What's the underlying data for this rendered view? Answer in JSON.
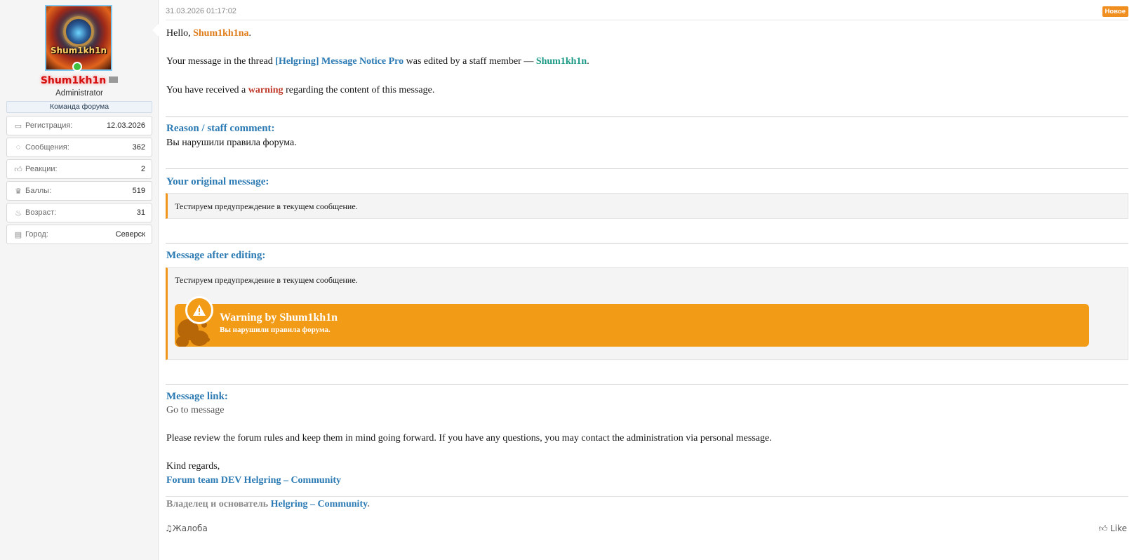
{
  "user": {
    "username": "Shum1kh1n",
    "title": "Administrator",
    "team_badge": "Команда форума",
    "avatar_text": "Shum1kh1n",
    "stats": [
      {
        "icon": "calendar-icon",
        "label": "Регистрация:",
        "value": "12.03.2026"
      },
      {
        "icon": "messages-icon",
        "label": "Сообщения:",
        "value": "362"
      },
      {
        "icon": "thumbs-up-icon",
        "label": "Реакции:",
        "value": "2"
      },
      {
        "icon": "trophy-icon",
        "label": "Баллы:",
        "value": "519"
      },
      {
        "icon": "birthday-cake-icon",
        "label": "Возраст:",
        "value": "31"
      },
      {
        "icon": "map-icon",
        "label": "Город:",
        "value": "Северск"
      }
    ]
  },
  "post": {
    "date": "31.03.2026 01:17:02",
    "new_badge": "Новое",
    "greeting_prefix": "Hello, ",
    "greeting_name": "Shum1kh1na",
    "greeting_suffix": ".",
    "line1_prefix": "Your message in the thread ",
    "thread_title": "[Helgring] Message Notice Pro",
    "line1_middle": " was edited by a staff member — ",
    "staff_name": "Shum1kh1n",
    "line1_suffix": ".",
    "line2_prefix": "You have received a ",
    "warning_word": "warning",
    "line2_suffix": " regarding the content of this message.",
    "reason_heading": "Reason / staff comment:",
    "reason_text": "Вы нарушили правила форума.",
    "original_heading": "Your original message:",
    "original_text": "Тестируем предупреждение в текущем сообщение.",
    "after_heading": "Message after editing:",
    "after_text": "Тестируем предупреждение в текущем сообщение.",
    "warning_box": {
      "title": "Warning by Shum1kh1n",
      "subtitle": "Вы нарушили правила форума."
    },
    "link_heading": "Message link:",
    "link_text": "Go to message",
    "rules_text": "Please review the forum rules and keep them in mind going forward. If you have any questions, you may contact the administration via personal message.",
    "regards": "Kind regards,",
    "team_signature": "Forum team DEV Helgring – Community",
    "signature_prefix": "Владелец и основатель ",
    "signature_link": "Helgring – Community",
    "signature_suffix": ".",
    "report_label": "Жалоба",
    "like_label": "Like"
  },
  "colors": {
    "accent_orange": "#f19b16",
    "link_blue": "#2b7ab3",
    "staff_teal": "#1c9a86",
    "warning_red": "#c0392b",
    "username_red": "#d40f0f"
  }
}
